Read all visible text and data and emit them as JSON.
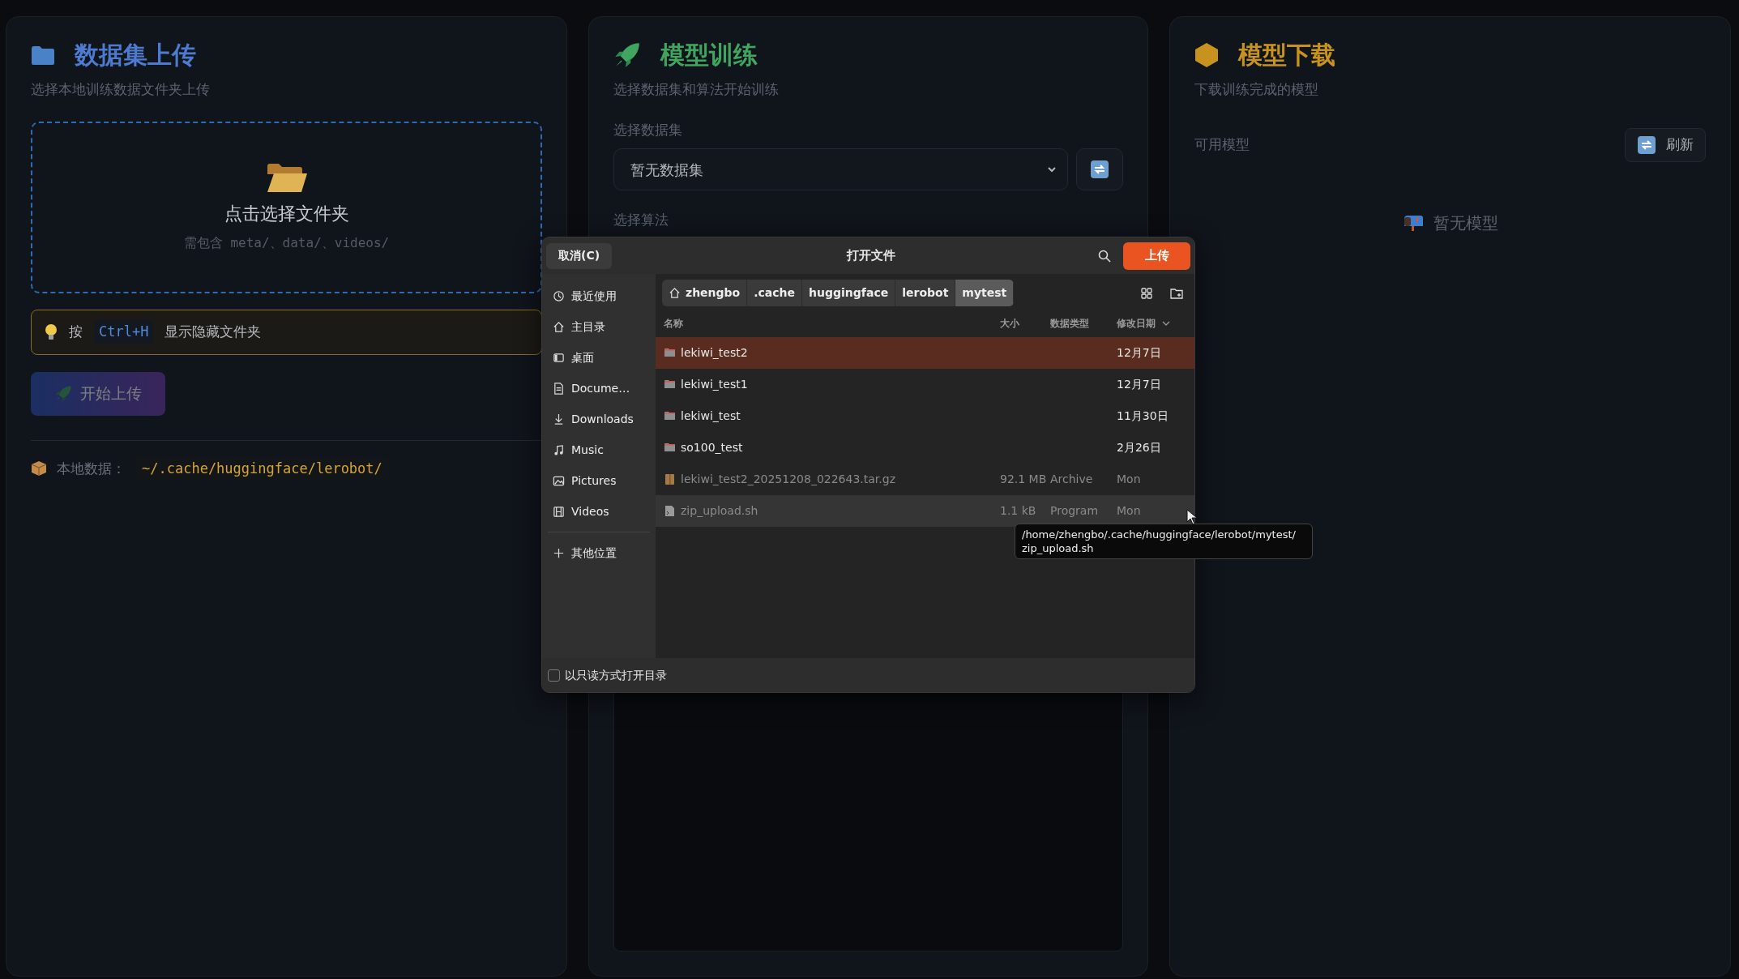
{
  "panels": [
    {
      "kind": "upload",
      "title": "数据集上传",
      "subtitle": "选择本地训练数据文件夹上传",
      "dropzone": {
        "title": "点击选择文件夹",
        "hint": "需包含 meta/、data/、videos/"
      },
      "tip": {
        "prefix": "按",
        "key": "Ctrl+H",
        "suffix": "显示隐藏文件夹"
      },
      "upload_button": {
        "label": "开始上传",
        "disabled": true
      },
      "local_data": {
        "label": "本地数据：",
        "path": "~/.cache/huggingface/lerobot/"
      }
    },
    {
      "kind": "train",
      "title": "模型训练",
      "subtitle": "选择数据集和算法开始训练",
      "dataset_label": "选择数据集",
      "dataset_select": {
        "value": "暂无数据集"
      },
      "algorithm_label": "选择算法"
    },
    {
      "kind": "download",
      "title": "模型下载",
      "subtitle": "下载训练完成的模型",
      "models_label": "可用模型",
      "refresh_button": {
        "label": "刷新"
      },
      "empty_text": "暂无模型"
    }
  ],
  "dialog": {
    "title": "打开文件",
    "cancel_button": "取消(C)",
    "confirm_button": "上传",
    "breadcrumb": [
      {
        "label": "zhengbo",
        "kind": "home",
        "selected": false
      },
      {
        "label": ".cache",
        "kind": "dir",
        "selected": false
      },
      {
        "label": "huggingface",
        "kind": "dir",
        "selected": false
      },
      {
        "label": "lerobot",
        "kind": "dir",
        "selected": false
      },
      {
        "label": "mytest",
        "kind": "dir",
        "selected": true
      }
    ],
    "places": [
      {
        "label": "最近使用",
        "kind": "recent"
      },
      {
        "label": "主目录",
        "kind": "home"
      },
      {
        "label": "桌面",
        "kind": "desktop"
      },
      {
        "label": "Docume…",
        "kind": "documents"
      },
      {
        "label": "Downloads",
        "kind": "downloads"
      },
      {
        "label": "Music",
        "kind": "music"
      },
      {
        "label": "Pictures",
        "kind": "pictures"
      },
      {
        "label": "Videos",
        "kind": "videos"
      }
    ],
    "other_places": "其他位置",
    "columns": [
      "名称",
      "大小",
      "数据类型",
      "修改日期"
    ],
    "files": [
      {
        "name": "lekiwi_test2",
        "kind": "folder",
        "modified": "12月7日",
        "selected": true,
        "dimmed": false,
        "hovered": false
      },
      {
        "name": "lekiwi_test1",
        "kind": "folder",
        "modified": "12月7日",
        "selected": false,
        "dimmed": false,
        "hovered": false
      },
      {
        "name": "lekiwi_test",
        "kind": "folder",
        "modified": "11月30日",
        "selected": false,
        "dimmed": false,
        "hovered": false
      },
      {
        "name": "so100_test",
        "kind": "folder",
        "modified": "2月26日",
        "selected": false,
        "dimmed": false,
        "hovered": false
      },
      {
        "name": "lekiwi_test2_20251208_022643.tar.gz",
        "kind": "archive",
        "size": "92.1 MB",
        "type": "Archive",
        "modified": "Mon",
        "selected": false,
        "dimmed": true,
        "hovered": false
      },
      {
        "name": "zip_upload.sh",
        "kind": "script",
        "size": "1.1 kB",
        "type": "Program",
        "modified": "Mon",
        "selected": false,
        "dimmed": true,
        "hovered": true
      }
    ],
    "tooltip": [
      "/home/zhengbo/.cache/huggingface/lerobot/mytest/",
      "zip_upload.sh"
    ],
    "readonly_checkbox": {
      "label": "以只读方式打开目录",
      "checked": false
    }
  }
}
